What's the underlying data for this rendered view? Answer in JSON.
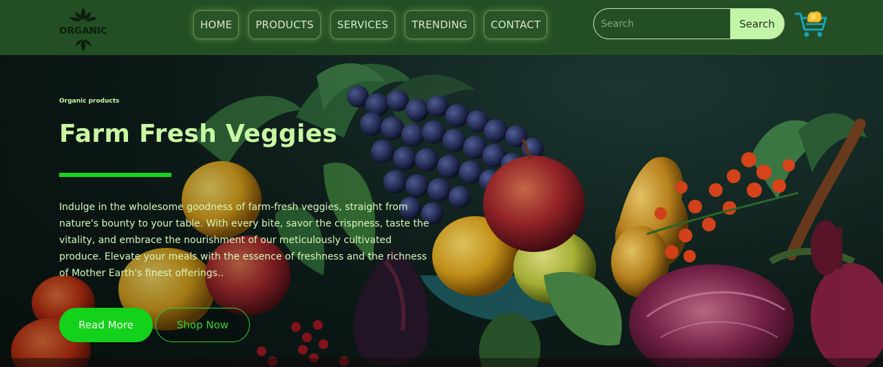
{
  "header": {
    "logo_text": "ORGANIC",
    "nav": [
      {
        "label": "HOME"
      },
      {
        "label": "PRODUCTS"
      },
      {
        "label": "SERVICES"
      },
      {
        "label": "TRENDING"
      },
      {
        "label": "CONTACT"
      }
    ],
    "search": {
      "placeholder": "Search",
      "button_label": "Search"
    },
    "cart_icon": "shopping-cart-icon"
  },
  "hero": {
    "eyebrow": "Organic products",
    "title": "Farm Fresh Veggies",
    "description": "Indulge in the wholesome goodness of farm-fresh veggies, straight from nature's bounty to your table. With every bite, savor the crispness, taste the vitality, and embrace the nourishment of our meticulously cultivated produce. Elevate your meals with the essence of freshness and the richness of Mother Earth's finest offerings..",
    "read_more_label": "Read More",
    "shop_now_label": "Shop Now"
  },
  "colors": {
    "header_bg": "#244f24",
    "accent_green": "#14d11b",
    "title_green": "#c9f7a2",
    "search_button_bg": "#c3f5a8"
  }
}
